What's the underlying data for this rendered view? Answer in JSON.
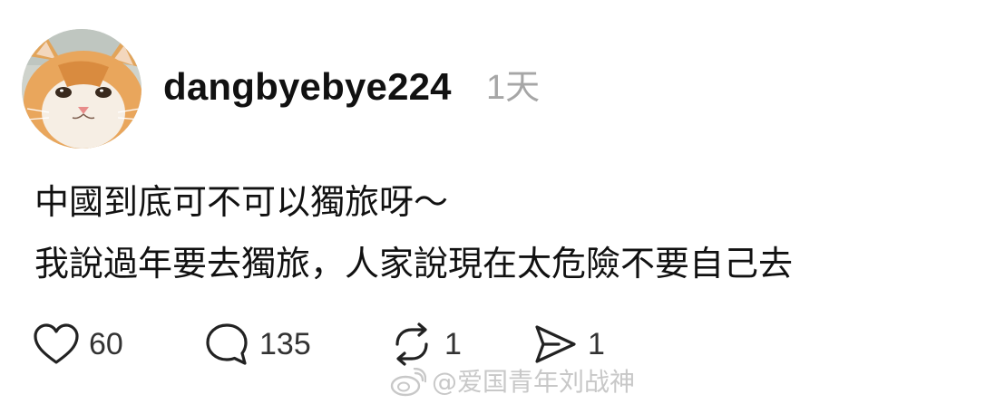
{
  "post": {
    "username": "dangbyebye224",
    "time": "1天",
    "lines": [
      "中國到底可不可以獨旅呀～",
      "我說過年要去獨旅，人家說現在太危險不要自己去"
    ]
  },
  "actions": {
    "like": {
      "icon": "heart-icon",
      "count": "60"
    },
    "reply": {
      "icon": "comment-icon",
      "count": "135"
    },
    "repost": {
      "icon": "repost-icon",
      "count": "1"
    },
    "share": {
      "icon": "send-icon",
      "count": "1"
    }
  },
  "watermark": {
    "icon": "weibo-logo",
    "text": "@爱国青年刘战神"
  },
  "colors": {
    "text": "#111111",
    "muted": "#a6a6a6",
    "watermark": "#c8c8c8"
  }
}
